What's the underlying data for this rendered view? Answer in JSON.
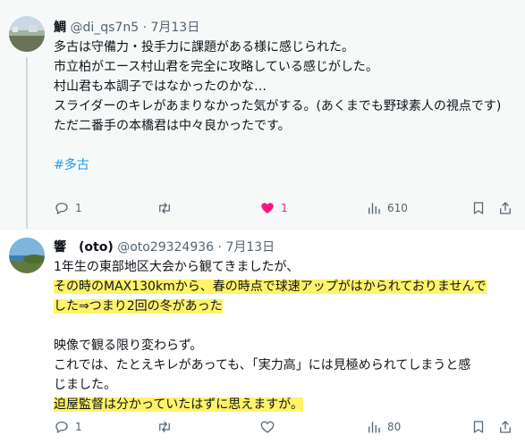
{
  "posts": [
    {
      "name": "鯛",
      "handle": "@di_qs7n5",
      "sep": "·",
      "date": "7月13日",
      "lines": [
        "多古は守備力・投手力に課題がある様に感じられた。",
        "市立柏がエース村山君を完全に攻略している感じがした。",
        "村山君も本調子ではなかったのかな…",
        "スライダーのキレがあまりなかった気がする。(あくまでも野球素人の視点です)",
        "ただ二番手の本橋君は中々良かったです。",
        "",
        "#多古"
      ],
      "replies": "1",
      "retweets": "",
      "likes": "1",
      "views": "610"
    },
    {
      "name": "響　(oto)",
      "handle": "@oto29324936",
      "sep": "·",
      "date": "7月13日",
      "lines": [
        "1年生の東部地区大会から観てきましたが、",
        "その時のMAX130kmから、春の時点で球速アップがはかられておりませんで",
        "した⇒つまり2回の冬があった",
        "",
        "映像で観る限り変わらず。",
        "これでは、たとえキレがあっても、「実力高」には見極められてしまうと感",
        "じました。",
        "迫屋監督は分かっていたはずに思えますが。"
      ],
      "replies": "1",
      "retweets": "",
      "likes": "",
      "views": "80"
    }
  ],
  "colors": {
    "text": "#0f1419",
    "muted": "#536471",
    "link": "#1d9bf0",
    "like": "#f91880",
    "highlight": "#fff36a"
  },
  "icons": [
    "reply-icon",
    "retweet-icon",
    "heart-icon",
    "views-icon",
    "bookmark-icon",
    "share-icon"
  ]
}
